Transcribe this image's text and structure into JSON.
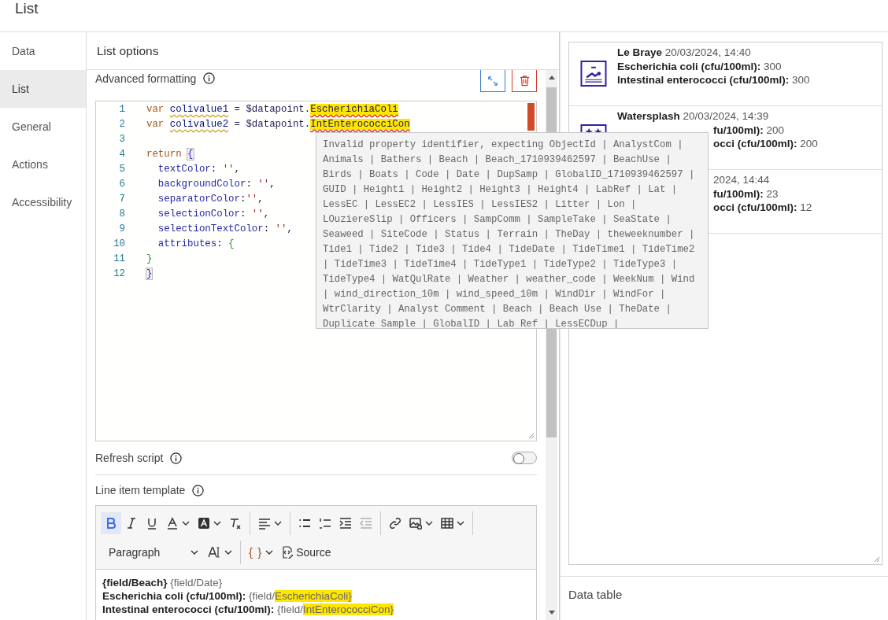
{
  "header": {
    "title": "List"
  },
  "sidebar": [
    {
      "label": "Data",
      "selected": false
    },
    {
      "label": "List",
      "selected": true
    },
    {
      "label": "General",
      "selected": false
    },
    {
      "label": "Actions",
      "selected": false
    },
    {
      "label": "Accessibility",
      "selected": false
    }
  ],
  "panel": {
    "title": "List options"
  },
  "advanced_formatting": {
    "label": "Advanced formatting",
    "code_lines": [
      {
        "number": "1",
        "tokens": [
          {
            "t": "var ",
            "kind": "keyword"
          },
          {
            "t": "colivalue1",
            "kind": "warning"
          },
          {
            "t": " = $datapoint.",
            "kind": "plain"
          },
          {
            "t": "EscherichiaColi",
            "kind": "error"
          }
        ]
      },
      {
        "number": "2",
        "tokens": [
          {
            "t": "var ",
            "kind": "keyword"
          },
          {
            "t": "colivalue2",
            "kind": "warning"
          },
          {
            "t": " = $datapoint.",
            "kind": "plain"
          },
          {
            "t": "IntEnterococciCon",
            "kind": "error"
          }
        ]
      },
      {
        "number": "3"
      },
      {
        "number": "4",
        "tokens": [
          {
            "t": "return ",
            "kind": "keyword"
          },
          {
            "t": "{",
            "kind": "bracket"
          }
        ]
      },
      {
        "number": "5",
        "tokens": [
          {
            "t": "  textColor",
            "kind": "property"
          },
          {
            "t": ": ",
            "kind": "plain"
          },
          {
            "t": "''",
            "kind": "string"
          },
          {
            "t": ",",
            "kind": "plain"
          }
        ]
      },
      {
        "number": "6",
        "tokens": [
          {
            "t": "  backgroundColor",
            "kind": "property"
          },
          {
            "t": ": ",
            "kind": "plain"
          },
          {
            "t": "''",
            "kind": "string"
          },
          {
            "t": ",",
            "kind": "plain"
          }
        ]
      },
      {
        "number": "7",
        "tokens": [
          {
            "t": "  separatorColor",
            "kind": "property"
          },
          {
            "t": ":",
            "kind": "plain"
          },
          {
            "t": "''",
            "kind": "string"
          },
          {
            "t": ",",
            "kind": "plain"
          }
        ]
      },
      {
        "number": "8",
        "tokens": [
          {
            "t": "  selectionColor",
            "kind": "property"
          },
          {
            "t": ": ",
            "kind": "plain"
          },
          {
            "t": "''",
            "kind": "string"
          },
          {
            "t": ",",
            "kind": "plain"
          }
        ]
      },
      {
        "number": "9",
        "tokens": [
          {
            "t": "  selectionTextColor",
            "kind": "property"
          },
          {
            "t": ": ",
            "kind": "plain"
          },
          {
            "t": "''",
            "kind": "string"
          },
          {
            "t": ",",
            "kind": "plain"
          }
        ]
      },
      {
        "number": "10",
        "tokens": [
          {
            "t": "  attributes",
            "kind": "property"
          },
          {
            "t": ": ",
            "kind": "plain"
          },
          {
            "t": "{",
            "kind": "brace"
          }
        ]
      },
      {
        "number": "11",
        "tokens": [
          {
            "t": "}",
            "kind": "brace"
          }
        ]
      },
      {
        "number": "12",
        "tokens": [
          {
            "t": "}",
            "kind": "bracket"
          }
        ]
      }
    ]
  },
  "tooltip": {
    "text": "Invalid property identifier, expecting ObjectId | AnalystCom | Animals | Bathers | Beach | Beach_1710939462597 | BeachUse | Birds | Boats | Code | Date | DupSamp | GlobalID_1710939462597 | GUID | Height1 | Height2 | Height3 | Height4 | LabRef | Lat | LessEC | LessEC2 | LessIES | LessIES2 | Litter | Lon | LOuziereSlip | Officers | SampComm | SampleTake | SeaState | Seaweed | SiteCode | Status | Terrain | TheDay | theweeknumber | Tide1 | Tide2 | Tide3 | Tide4 | TideDate | TideTime1 | TideTime2 | TideTime3 | TideTime4 | TideType1 | TideType2 | TideType3 | TideType4 | WatQulRate | Weather | weather_code | WeekNum | Wind | wind_direction_10m | wind_speed_10m | WindDir | WindFor | WtrClarity | Analyst Comment | Beach | Beach Use | TheDate | Duplicate Sample | GlobalID | Lab Ref | LessECDup |"
  },
  "refresh_script": {
    "label": "Refresh script",
    "on": false
  },
  "line_item_template": {
    "label": "Line item template",
    "toolbar_rows": [
      [
        {
          "kind": "bold",
          "selected": true,
          "disabled": false,
          "dropdown": false
        },
        {
          "kind": "italic",
          "selected": false,
          "disabled": false,
          "dropdown": false
        },
        {
          "kind": "underline",
          "selected": false,
          "disabled": false,
          "dropdown": false
        },
        {
          "kind": "font-color",
          "selected": false,
          "disabled": false,
          "dropdown": true
        },
        {
          "kind": "highlight",
          "selected": false,
          "disabled": false,
          "dropdown": true
        },
        {
          "kind": "clear-format",
          "selected": false,
          "disabled": false,
          "dropdown": false
        },
        {
          "kind": "separator"
        },
        {
          "kind": "align",
          "selected": false,
          "disabled": false,
          "dropdown": true
        },
        {
          "kind": "separator"
        },
        {
          "kind": "bullet-list",
          "selected": false,
          "disabled": false,
          "dropdown": false
        },
        {
          "kind": "numbered-list",
          "selected": false,
          "disabled": false,
          "dropdown": false
        },
        {
          "kind": "indent",
          "selected": false,
          "disabled": false,
          "dropdown": false
        },
        {
          "kind": "outdent",
          "selected": false,
          "disabled": true,
          "dropdown": false
        },
        {
          "kind": "separator"
        },
        {
          "kind": "link",
          "selected": false,
          "disabled": false,
          "dropdown": false
        },
        {
          "kind": "image",
          "selected": false,
          "disabled": false,
          "dropdown": true
        },
        {
          "kind": "table",
          "selected": false,
          "disabled": false,
          "dropdown": true
        },
        {
          "kind": "separator"
        }
      ],
      [
        {
          "kind": "paragraph",
          "label": "Paragraph"
        },
        {
          "kind": "font-size"
        },
        {
          "kind": "separator"
        },
        {
          "kind": "braces",
          "label": "{ }"
        },
        {
          "kind": "source",
          "label": "Source"
        }
      ]
    ],
    "lines": [
      [
        {
          "text": "{field/Beach}",
          "kind": "bold"
        },
        {
          "text": " {field/Date}",
          "kind": "field"
        }
      ],
      [
        {
          "text": "Escherichia coli (cfu/100ml):",
          "kind": "bold"
        },
        {
          "text": " {field/",
          "kind": "field"
        },
        {
          "text": "EscherichiaColi}",
          "kind": "highlight"
        }
      ],
      [
        {
          "text": "Intestinal enterococci (cfu/100ml):",
          "kind": "bold"
        },
        {
          "text": " {field/",
          "kind": "field"
        },
        {
          "text": "IntEnterococciCon}",
          "kind": "highlight"
        }
      ]
    ]
  },
  "list_items": [
    {
      "title": {
        "text": "**Le Braye** 20/03/2024, 14:40",
        "covered": false
      },
      "lines": [
        {
          "text": "**Escherichia coli (cfu/100ml):** 300",
          "covered": false
        },
        {
          "text": "**Intestinal enterococci (cfu/100ml):** 300",
          "covered": false
        }
      ]
    },
    {
      "title": {
        "text": "**Watersplash** 20/03/2024, 14:39",
        "covered": false
      },
      "lines": [
        {
          "text": "**fu/100ml):** 200",
          "covered": true
        },
        {
          "text": "**occi (cfu/100ml):** 200",
          "covered": true
        }
      ]
    },
    {
      "title": {
        "text": "2024, 14:44",
        "covered": true
      },
      "lines": [
        {
          "text": "**fu/100ml):** 23",
          "covered": true
        },
        {
          "text": "**occi (cfu/100ml):** 12",
          "covered": true
        }
      ]
    }
  ],
  "data_table": {
    "label": "Data table"
  }
}
